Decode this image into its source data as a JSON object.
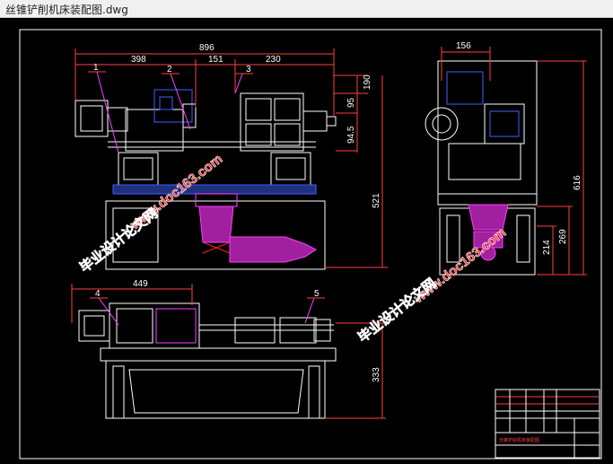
{
  "window": {
    "title": "丝锥铲削机床装配图.dwg"
  },
  "colors": {
    "background": "#000000",
    "outline": "#ffffff",
    "dimension": "#ff4040",
    "part": "#ff40ff",
    "detail": "#4060ff",
    "centerline": "#ff2020",
    "watermark": "#ff3030"
  },
  "dimensions": {
    "overall_width": "896",
    "left_width": "398",
    "mid_width": "151",
    "right_width": "230",
    "top_height": "190",
    "height_95": "95",
    "height_945": "94.5",
    "height_521": "521",
    "side_width": "156",
    "side_height_616": "616",
    "side_height_269": "269",
    "side_height_214": "214",
    "bottom_width": "449",
    "bottom_height": "333"
  },
  "part_labels": [
    "1",
    "2",
    "3",
    "4",
    "5"
  ],
  "watermarks": {
    "site": "www.doc163.com",
    "name": "毕业设计论文网"
  },
  "title_block": {
    "caption": "丝锥铲削机床装配图"
  }
}
